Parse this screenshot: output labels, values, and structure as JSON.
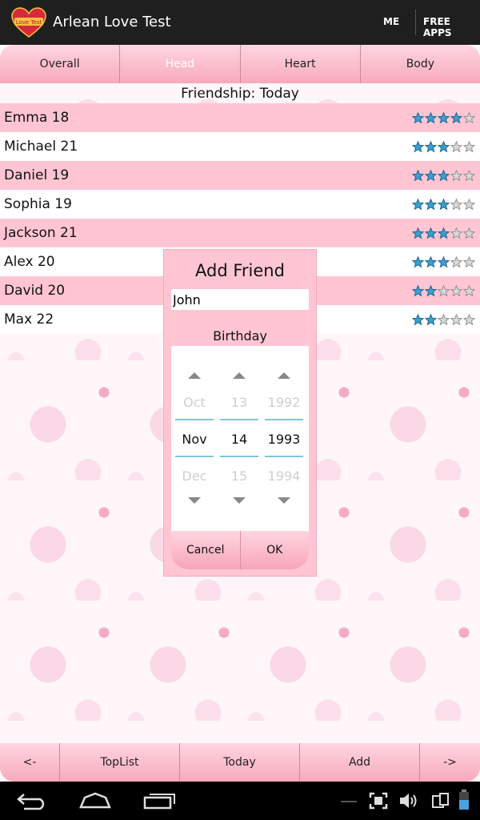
{
  "app": {
    "title": "Arlean Love Test",
    "logo_text": "Love Test"
  },
  "actionbar": {
    "me_label": "ME",
    "free_apps_label": "FREE APPS"
  },
  "tabs": [
    {
      "label": "Overall",
      "active": false
    },
    {
      "label": "Head",
      "active": true
    },
    {
      "label": "Heart",
      "active": false
    },
    {
      "label": "Body",
      "active": false
    }
  ],
  "list_header": "Friendship: Today",
  "friends": [
    {
      "name": "Emma 18",
      "stars": 4
    },
    {
      "name": "Michael 21",
      "stars": 3
    },
    {
      "name": "Daniel 19",
      "stars": 3
    },
    {
      "name": "Sophia 19",
      "stars": 3
    },
    {
      "name": "Jackson 21",
      "stars": 3
    },
    {
      "name": "Alex 20",
      "stars": 3
    },
    {
      "name": "David 20",
      "stars": 2
    },
    {
      "name": "Max 22",
      "stars": 2
    }
  ],
  "dialog": {
    "title": "Add Friend",
    "name_value": "John",
    "birthday_label": "Birthday",
    "month": {
      "prev": "Oct",
      "current": "Nov",
      "next": "Dec"
    },
    "day": {
      "prev": "13",
      "current": "14",
      "next": "15"
    },
    "year": {
      "prev": "1992",
      "current": "1993",
      "next": "1994"
    },
    "cancel_label": "Cancel",
    "ok_label": "OK"
  },
  "bottombar": {
    "prev_label": "<-",
    "toplist_label": "TopList",
    "today_label": "Today",
    "add_label": "Add",
    "next_label": "->"
  },
  "colors": {
    "accent_pink": "#ffc5d3",
    "tab_pink": "#f7a9bd",
    "star_blue": "#3a9fd0",
    "picker_line": "#7fc6d8"
  }
}
